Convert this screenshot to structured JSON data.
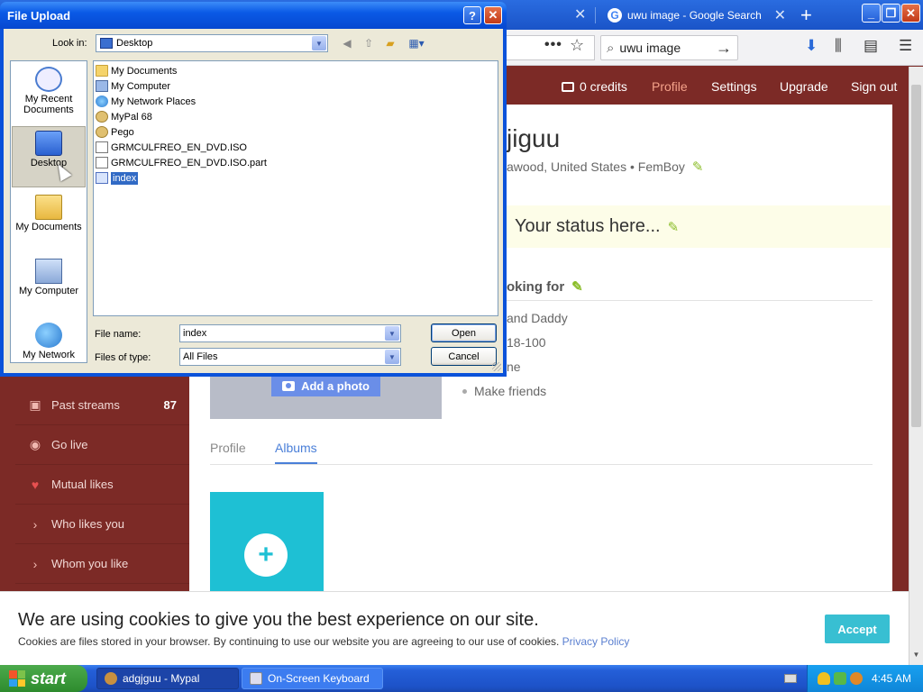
{
  "browser": {
    "tabs": [
      {
        "label": "uwu image - Google Search"
      }
    ],
    "search": {
      "value": "uwu image"
    }
  },
  "site": {
    "nav": {
      "credits": "0 credits",
      "profile": "Profile",
      "settings": "Settings",
      "upgrade": "Upgrade",
      "signout": "Sign out"
    },
    "profile": {
      "name": "jiguu",
      "location": "awood, United States",
      "tag": "FemBoy",
      "status": "Your status here...",
      "looking_for_title": "oking for",
      "looking_for": [
        "and Daddy",
        "18-100",
        "ne",
        "Make friends"
      ]
    },
    "add_photo": "Add a photo",
    "tabs": {
      "profile": "Profile",
      "albums": "Albums"
    },
    "menu": [
      {
        "label": "Past streams",
        "count": "87"
      },
      {
        "label": "Go live",
        "count": ""
      },
      {
        "label": "Mutual likes",
        "count": ""
      },
      {
        "label": "Who likes you",
        "count": ""
      },
      {
        "label": "Whom you like",
        "count": ""
      }
    ]
  },
  "cookie": {
    "title": "We are using cookies to give you the best experience on our site.",
    "text": "Cookies are files stored in your browser. By continuing to use our website you are agreeing to our use of cookies.",
    "link": "Privacy Policy",
    "accept": "Accept"
  },
  "dialog": {
    "title": "File Upload",
    "look_in_label": "Look in:",
    "look_in_value": "Desktop",
    "places": [
      {
        "label1": "My Recent",
        "label2": "Documents"
      },
      {
        "label1": "Desktop",
        "label2": ""
      },
      {
        "label1": "My Documents",
        "label2": ""
      },
      {
        "label1": "My Computer",
        "label2": ""
      },
      {
        "label1": "My Network",
        "label2": ""
      }
    ],
    "files": [
      {
        "name": "My Documents",
        "icon": "folder"
      },
      {
        "name": "My Computer",
        "icon": "computer"
      },
      {
        "name": "My Network Places",
        "icon": "network"
      },
      {
        "name": "MyPal 68",
        "icon": "app"
      },
      {
        "name": "Pego",
        "icon": "app"
      },
      {
        "name": "GRMCULFREO_EN_DVD.ISO",
        "icon": "file"
      },
      {
        "name": "GRMCULFREO_EN_DVD.ISO.part",
        "icon": "file"
      },
      {
        "name": "index",
        "icon": "file",
        "selected": true
      }
    ],
    "file_name_label": "File name:",
    "file_name_value": "index",
    "file_type_label": "Files of type:",
    "file_type_value": "All Files",
    "open": "Open",
    "cancel": "Cancel"
  },
  "taskbar": {
    "start": "start",
    "tasks": [
      {
        "label": "adgjguu - Mypal"
      },
      {
        "label": "On-Screen Keyboard"
      }
    ],
    "clock": "4:45 AM"
  }
}
